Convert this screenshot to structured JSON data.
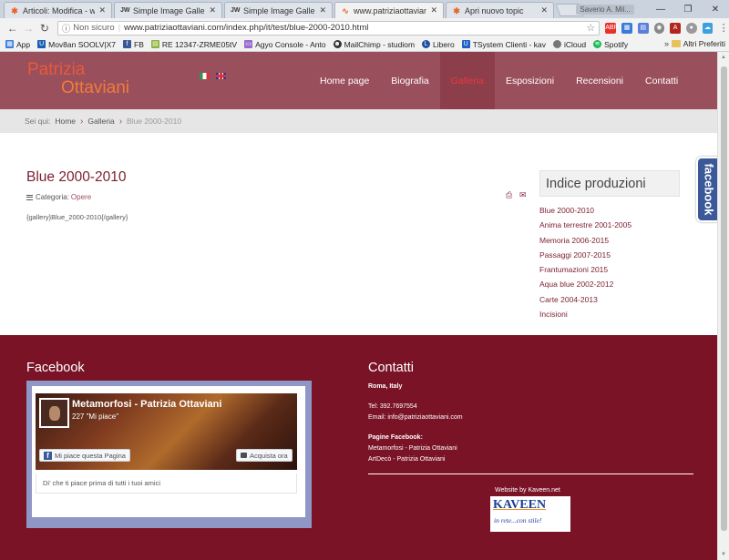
{
  "browser": {
    "tabs": [
      {
        "icon": "joomla-icon",
        "label": "Articoli: Modifica - www.p",
        "active": false
      },
      {
        "icon": "jw-icon",
        "label": "Simple Image Gallery No",
        "active": false
      },
      {
        "icon": "jw-icon",
        "label": "Simple Image Gallery - Jo",
        "active": false
      },
      {
        "icon": "pulse-icon",
        "label": "www.patriziaottaviani.co",
        "active": true
      },
      {
        "icon": "joomla-icon",
        "label": "Apri nuovo topic",
        "active": false
      }
    ],
    "profile": "Saverio A. Mil...",
    "address": {
      "security": "Non sicuro",
      "url": "www.patriziaottaviani.com/index.php/it/test/blue-2000-2010.html"
    },
    "bookmarks": [
      {
        "label": "App",
        "color": "#3b7de0"
      },
      {
        "label": "Mov8an SOOLV|X7",
        "color": "#1a5fb4"
      },
      {
        "label": "FB",
        "color": "#3b5998"
      },
      {
        "label": "RE 12347-ZRME05tV",
        "color": "#8bb13a"
      },
      {
        "label": "Agyo Console - Anto",
        "color": "#9a6ad0"
      },
      {
        "label": "MailChimp - studiom",
        "color": "#333333"
      },
      {
        "label": "Libero",
        "color": "#1e4fa0"
      },
      {
        "label": "TSystem Clienti - kav",
        "color": "#1e5fc8"
      },
      {
        "label": "iCloud",
        "color": "#777777"
      },
      {
        "label": "Spotify",
        "color": "#1db954"
      }
    ],
    "bookmarks_more": "»",
    "other_bookmarks": "Altri Preferiti"
  },
  "site": {
    "logo_line1": "Patrizia",
    "logo_line2": "Ottaviani",
    "nav": [
      {
        "label": "Home page",
        "active": false
      },
      {
        "label": "Biografia",
        "active": false
      },
      {
        "label": "Galleria",
        "active": true
      },
      {
        "label": "Esposizioni",
        "active": false
      },
      {
        "label": "Recensioni",
        "active": false
      },
      {
        "label": "Contatti",
        "active": false
      }
    ],
    "breadcrumb": {
      "prefix": "Sei qui:",
      "items": [
        "Home",
        "Galleria"
      ],
      "current": "Blue 2000-2010"
    },
    "article": {
      "title": "Blue 2000-2010",
      "category_label": "Categoria:",
      "category": "Opere",
      "body": "{gallery}Blue_2000-2010{/gallery}"
    },
    "sidebar": {
      "title": "Indice produzioni",
      "items": [
        "Blue 2000-2010",
        "Anima terrestre 2001-2005",
        "Memoria 2006-2015",
        "Passaggi 2007-2015",
        "Frantumazioni 2015",
        "Aqua blue 2002-2012",
        "Carte 2004-2013",
        "Incisioni"
      ]
    },
    "facebook_tab": "facebook",
    "footer": {
      "facebook_heading": "Facebook",
      "fb_widget": {
        "page_name": "Metamorfosi - Patrizia Ottaviani",
        "likes": "227 \"Mi piace\"",
        "like_button": "Mi piace questa Pagina",
        "shop_button": "Acquista ora",
        "friends_text": "Di' che ti piace prima di tutti i tuoi amici"
      },
      "contacts_heading": "Contatti",
      "city": "Roma, Italy",
      "phone": "Tel: 392.7697554",
      "email": "Email: info@patriziaottaviani.com",
      "fb_pages_label": "Pagine Facebook:",
      "fb_page1": "Metamorfosi - Patrizia Ottaviani",
      "fb_page2": "ArtDecò - Patrizia Ottaviani",
      "website_by": "Website by Kaveen.net",
      "kaveen_logo": "KAVEEN",
      "kaveen_tagline": "in rete...con stile!"
    }
  },
  "colors": {
    "header_bg": "#9a4f5c",
    "footer_bg": "#7a1326",
    "accent": "#7a1e2e",
    "active_nav": "#e63a3a"
  }
}
